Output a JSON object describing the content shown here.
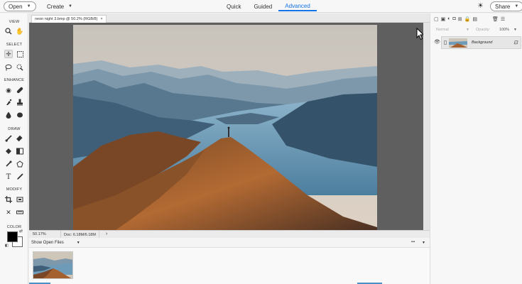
{
  "topbar": {
    "open_label": "Open",
    "create_label": "Create",
    "modes": [
      {
        "label": "Quick",
        "active": false
      },
      {
        "label": "Guided",
        "active": false
      },
      {
        "label": "Advanced",
        "active": true
      }
    ],
    "share_label": "Share",
    "accent_color": "#1473e6"
  },
  "toolbar": {
    "sections": {
      "view": "VIEW",
      "select": "SELECT",
      "enhance": "ENHANCE",
      "draw": "DRAW",
      "modify": "MODIFY",
      "color": "COLOR"
    },
    "tools": [
      "zoom-icon",
      "hand-icon",
      "move-icon",
      "marquee-icon",
      "lasso-icon",
      "quick-select-icon",
      "eye-icon",
      "spot-healing-icon",
      "smart-brush-icon",
      "clone-stamp-icon",
      "blur-icon",
      "sponge-icon",
      "brush-icon",
      "eraser-icon",
      "paint-bucket-icon",
      "gradient-icon",
      "eyedropper-icon",
      "custom-shape-icon",
      "type-icon",
      "pencil-icon",
      "crop-icon",
      "recompose-icon",
      "content-aware-move-icon",
      "straighten-icon"
    ],
    "foreground_color": "#000000",
    "background_color": "#ffffff"
  },
  "document": {
    "tab_title": "neon night 3.bmp @ 50.2% (RGB/8)",
    "close_glyph": "×",
    "zoom": "50.17%",
    "doc_size": "Doc: 6.18M/6.18M"
  },
  "photo_bin": {
    "selector_label": "Show Open Files",
    "more_glyph": "•••"
  },
  "layers_panel": {
    "blend_mode": "Normal",
    "opacity_label": "Opacity:",
    "opacity_value": "100%",
    "layers": [
      {
        "name": "Background",
        "visible": true
      }
    ]
  }
}
